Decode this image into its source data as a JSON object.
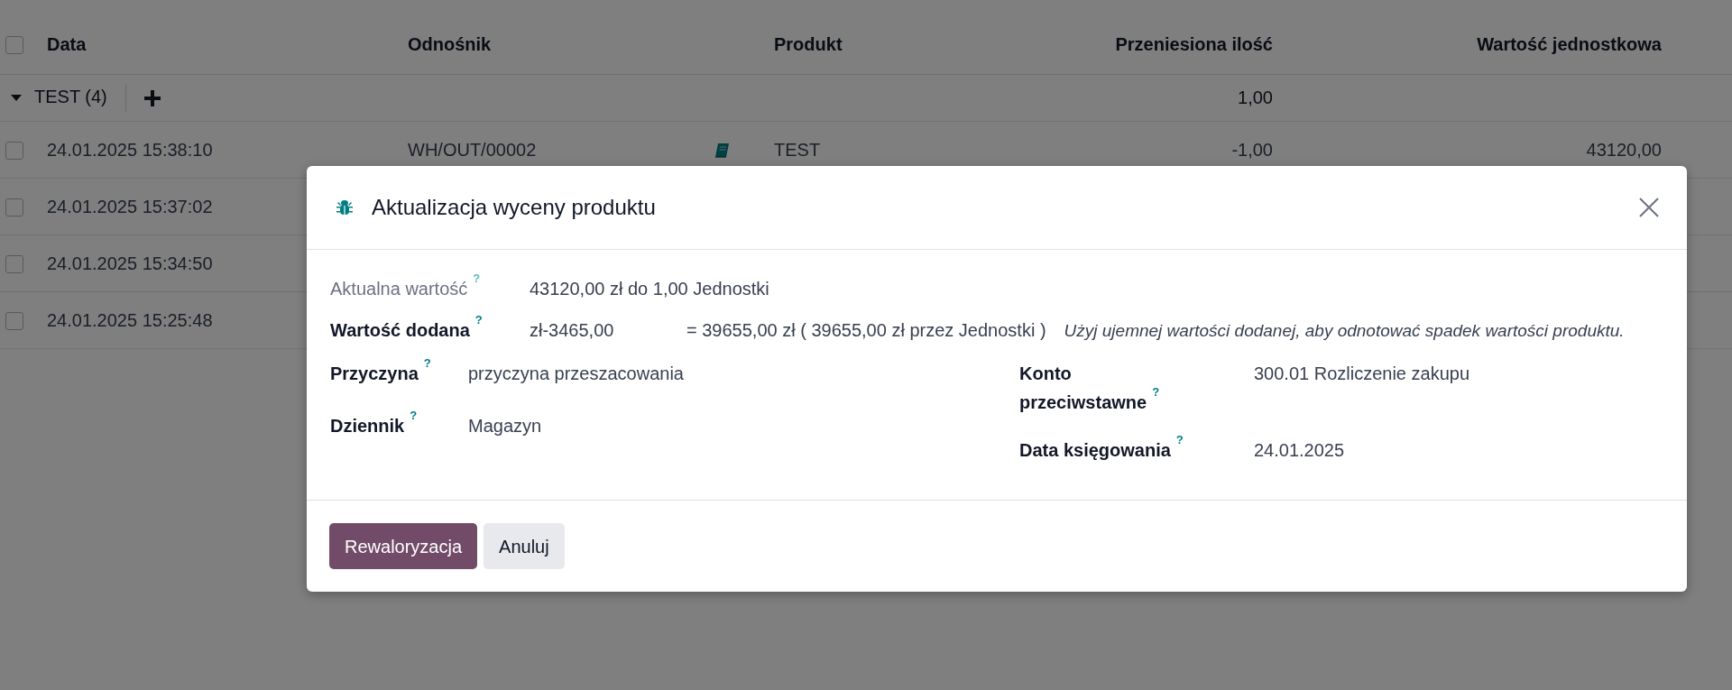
{
  "list": {
    "select_all": {
      "checked": false
    },
    "columns": [
      {
        "label": "Data"
      },
      {
        "label": "Odnośnik"
      },
      {
        "label": "Produkt"
      },
      {
        "label": "Przeniesiona ilość"
      },
      {
        "label": "Wartość jednostkowa"
      }
    ],
    "group": {
      "name": "TEST (4)",
      "expanded": true,
      "quantity": "1,00"
    },
    "rows": [
      {
        "checked": false,
        "date": "24.01.2025 15:38:10",
        "reference": "WH/OUT/00002",
        "product": "TEST",
        "quantity": "-1,00",
        "unit_value": "43120,00"
      },
      {
        "checked": false,
        "date": "24.01.2025 15:37:02"
      },
      {
        "checked": false,
        "date": "24.01.2025 15:34:50"
      },
      {
        "checked": false,
        "date": "24.01.2025 15:25:48"
      }
    ]
  },
  "dialog": {
    "title": "Aktualizacja wyceny produktu",
    "top_fields": [
      {
        "label": "Aktualna wartość",
        "help": "?",
        "readonly": true,
        "value": "43120,00 zł do 1,00 Jednostki"
      },
      {
        "label": "Wartość dodana",
        "help": "?",
        "readonly": false,
        "value": "zł-3465,00",
        "computed": "= 39655,00 zł ( 39655,00 zł przez Jednostki )",
        "hint": "Użyj ujemnej wartości dodanej, aby odnotować spadek wartości produktu."
      }
    ],
    "left_fields": [
      {
        "label": "Przyczyna",
        "help": "?",
        "readonly": false,
        "value": "przyczyna przeszacowania"
      },
      {
        "label": "Dziennik",
        "help": "?",
        "readonly": false,
        "value": "Magazyn"
      }
    ],
    "right_fields": [
      {
        "label": "Konto przeciwstawne",
        "help": "?",
        "readonly": false,
        "value": "300.01 Rozliczenie zakupu"
      },
      {
        "label": "Data księgowania",
        "help": "?",
        "readonly": false,
        "value": "24.01.2025"
      }
    ],
    "buttons": [
      {
        "label": "Rewaloryzacja",
        "kind": "primary"
      },
      {
        "label": "Anuluj",
        "kind": "secondary"
      }
    ]
  }
}
